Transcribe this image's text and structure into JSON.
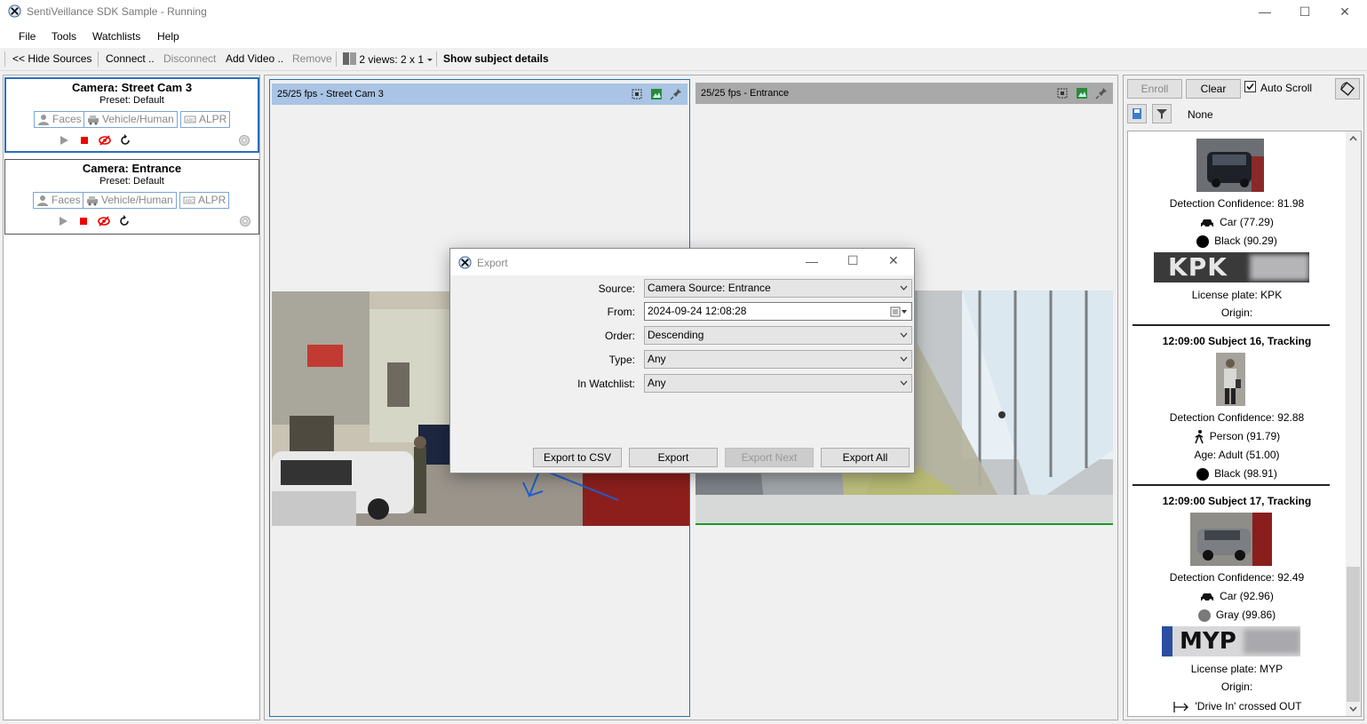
{
  "window": {
    "title": "SentiVeillance SDK Sample - Running",
    "minimize": "—",
    "maximize": "☐",
    "close": "✕"
  },
  "menu": [
    "File",
    "Tools",
    "Watchlists",
    "Help"
  ],
  "toolbar": {
    "hide_sources": "<< Hide Sources",
    "connect": "Connect ..",
    "disconnect": "Disconnect",
    "add_video": "Add Video ..",
    "remove": "Remove",
    "views": "2 views: 2 x 1",
    "show_details": "Show subject details"
  },
  "cameras": [
    {
      "title": "Camera: Street Cam 3",
      "preset": "Preset: Default",
      "faces": "Faces",
      "vehicle": "Vehicle/Human",
      "alpr": "ALPR"
    },
    {
      "title": "Camera: Entrance",
      "preset": "Preset: Default",
      "faces": "Faces",
      "vehicle": "Vehicle/Human",
      "alpr": "ALPR"
    }
  ],
  "views": [
    {
      "label": "25/25 fps  - Street Cam 3"
    },
    {
      "label": "25/25 fps  - Entrance"
    }
  ],
  "right": {
    "enroll": "Enroll",
    "clear": "Clear",
    "auto_scroll": "Auto Scroll",
    "auto_scroll_checked": true,
    "filter_value": "None"
  },
  "feed": {
    "item1": {
      "confidence": "Detection Confidence: 81.98",
      "type": "Car (77.29)",
      "color": "Black (90.29)",
      "color_hex": "#000000",
      "plate_text": "KPK",
      "plate_label": "License plate: KPK",
      "origin": "Origin:"
    },
    "item2": {
      "header": "12:09:00  Subject 16,  Tracking",
      "confidence": "Detection Confidence: 92.88",
      "type": "Person (91.79)",
      "age": "Age: Adult (51.00)",
      "color": "Black (98.91)",
      "color_hex": "#000000"
    },
    "item3": {
      "header": "12:09:00  Subject 17,  Tracking",
      "confidence": "Detection Confidence: 92.49",
      "type": "Car (92.96)",
      "color": "Gray (99.86)",
      "color_hex": "#7a7a7a",
      "plate_text": "MYP",
      "plate_label": "License plate: MYP",
      "origin": "Origin:",
      "event": "'Drive In' crossed OUT"
    }
  },
  "dialog": {
    "title": "Export",
    "source_label": "Source:",
    "source_value": "Camera Source: Entrance",
    "from_label": "From:",
    "from_value": "2024-09-24 12:08:28",
    "order_label": "Order:",
    "order_value": "Descending",
    "type_label": "Type:",
    "type_value": "Any",
    "watchlist_label": "In Watchlist:",
    "watchlist_value": "Any",
    "btn_csv": "Export to CSV",
    "btn_export": "Export",
    "btn_next": "Export Next",
    "btn_all": "Export All"
  }
}
